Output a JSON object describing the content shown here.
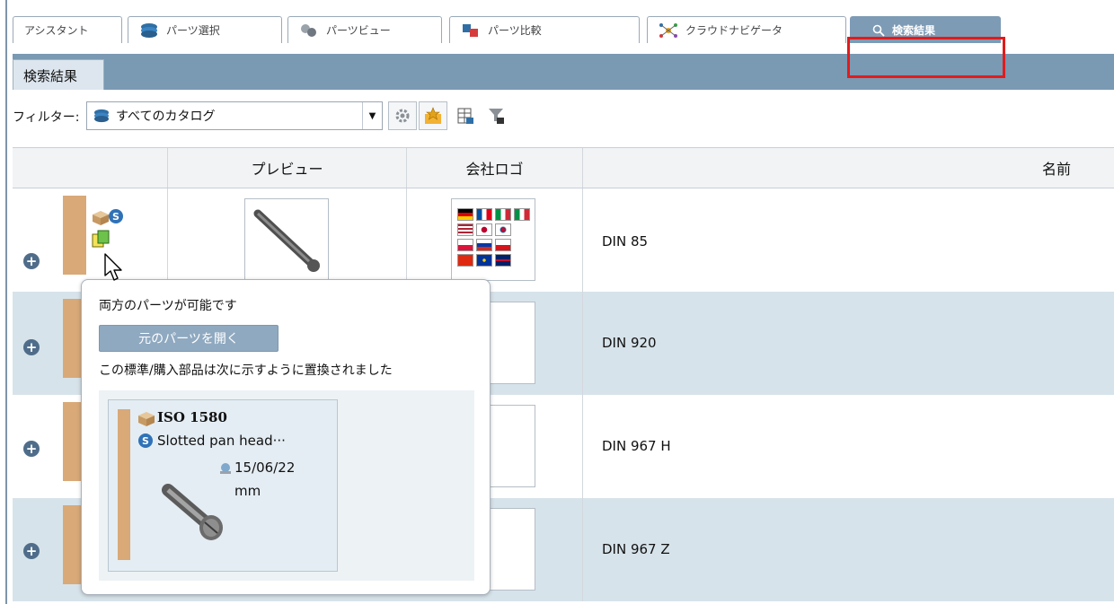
{
  "tabs": [
    {
      "label": "アシスタント",
      "icon": "none"
    },
    {
      "label": "パーツ選択",
      "icon": "catalog-stack-icon"
    },
    {
      "label": "パーツビュー",
      "icon": "parts-view-icon"
    },
    {
      "label": "パーツ比較",
      "icon": "parts-compare-icon"
    },
    {
      "label": "クラウドナビゲータ",
      "icon": "cloud-navigator-icon"
    },
    {
      "label": "検索結果",
      "icon": "search-icon",
      "active": true
    }
  ],
  "subtab": {
    "label": "検索結果"
  },
  "filter": {
    "label": "フィルター:",
    "selected": "すべてのカタログ"
  },
  "table": {
    "headers": {
      "preview": "プレビュー",
      "company_logo": "会社ロゴ",
      "name": "名前"
    },
    "rows": [
      {
        "name": "DIN 85"
      },
      {
        "name": "DIN 920"
      },
      {
        "name": "DIN 967 H"
      },
      {
        "name": "DIN 967 Z"
      }
    ]
  },
  "popup": {
    "title": "両方のパーツが可能です",
    "button": "元のパーツを開く",
    "description": "この標準/購入部品は次に示すように置換されました",
    "card": {
      "code": "ISO 1580",
      "description": "Slotted pan head···",
      "date": "15/06/22",
      "unit": "mm"
    }
  },
  "colors": {
    "accent_bar": "#7a99b3",
    "active_tab": "#7e9bb5",
    "tan_bar": "#d9a978",
    "row_alt": "#d7e3ea",
    "highlight_box": "#e21b1b"
  }
}
